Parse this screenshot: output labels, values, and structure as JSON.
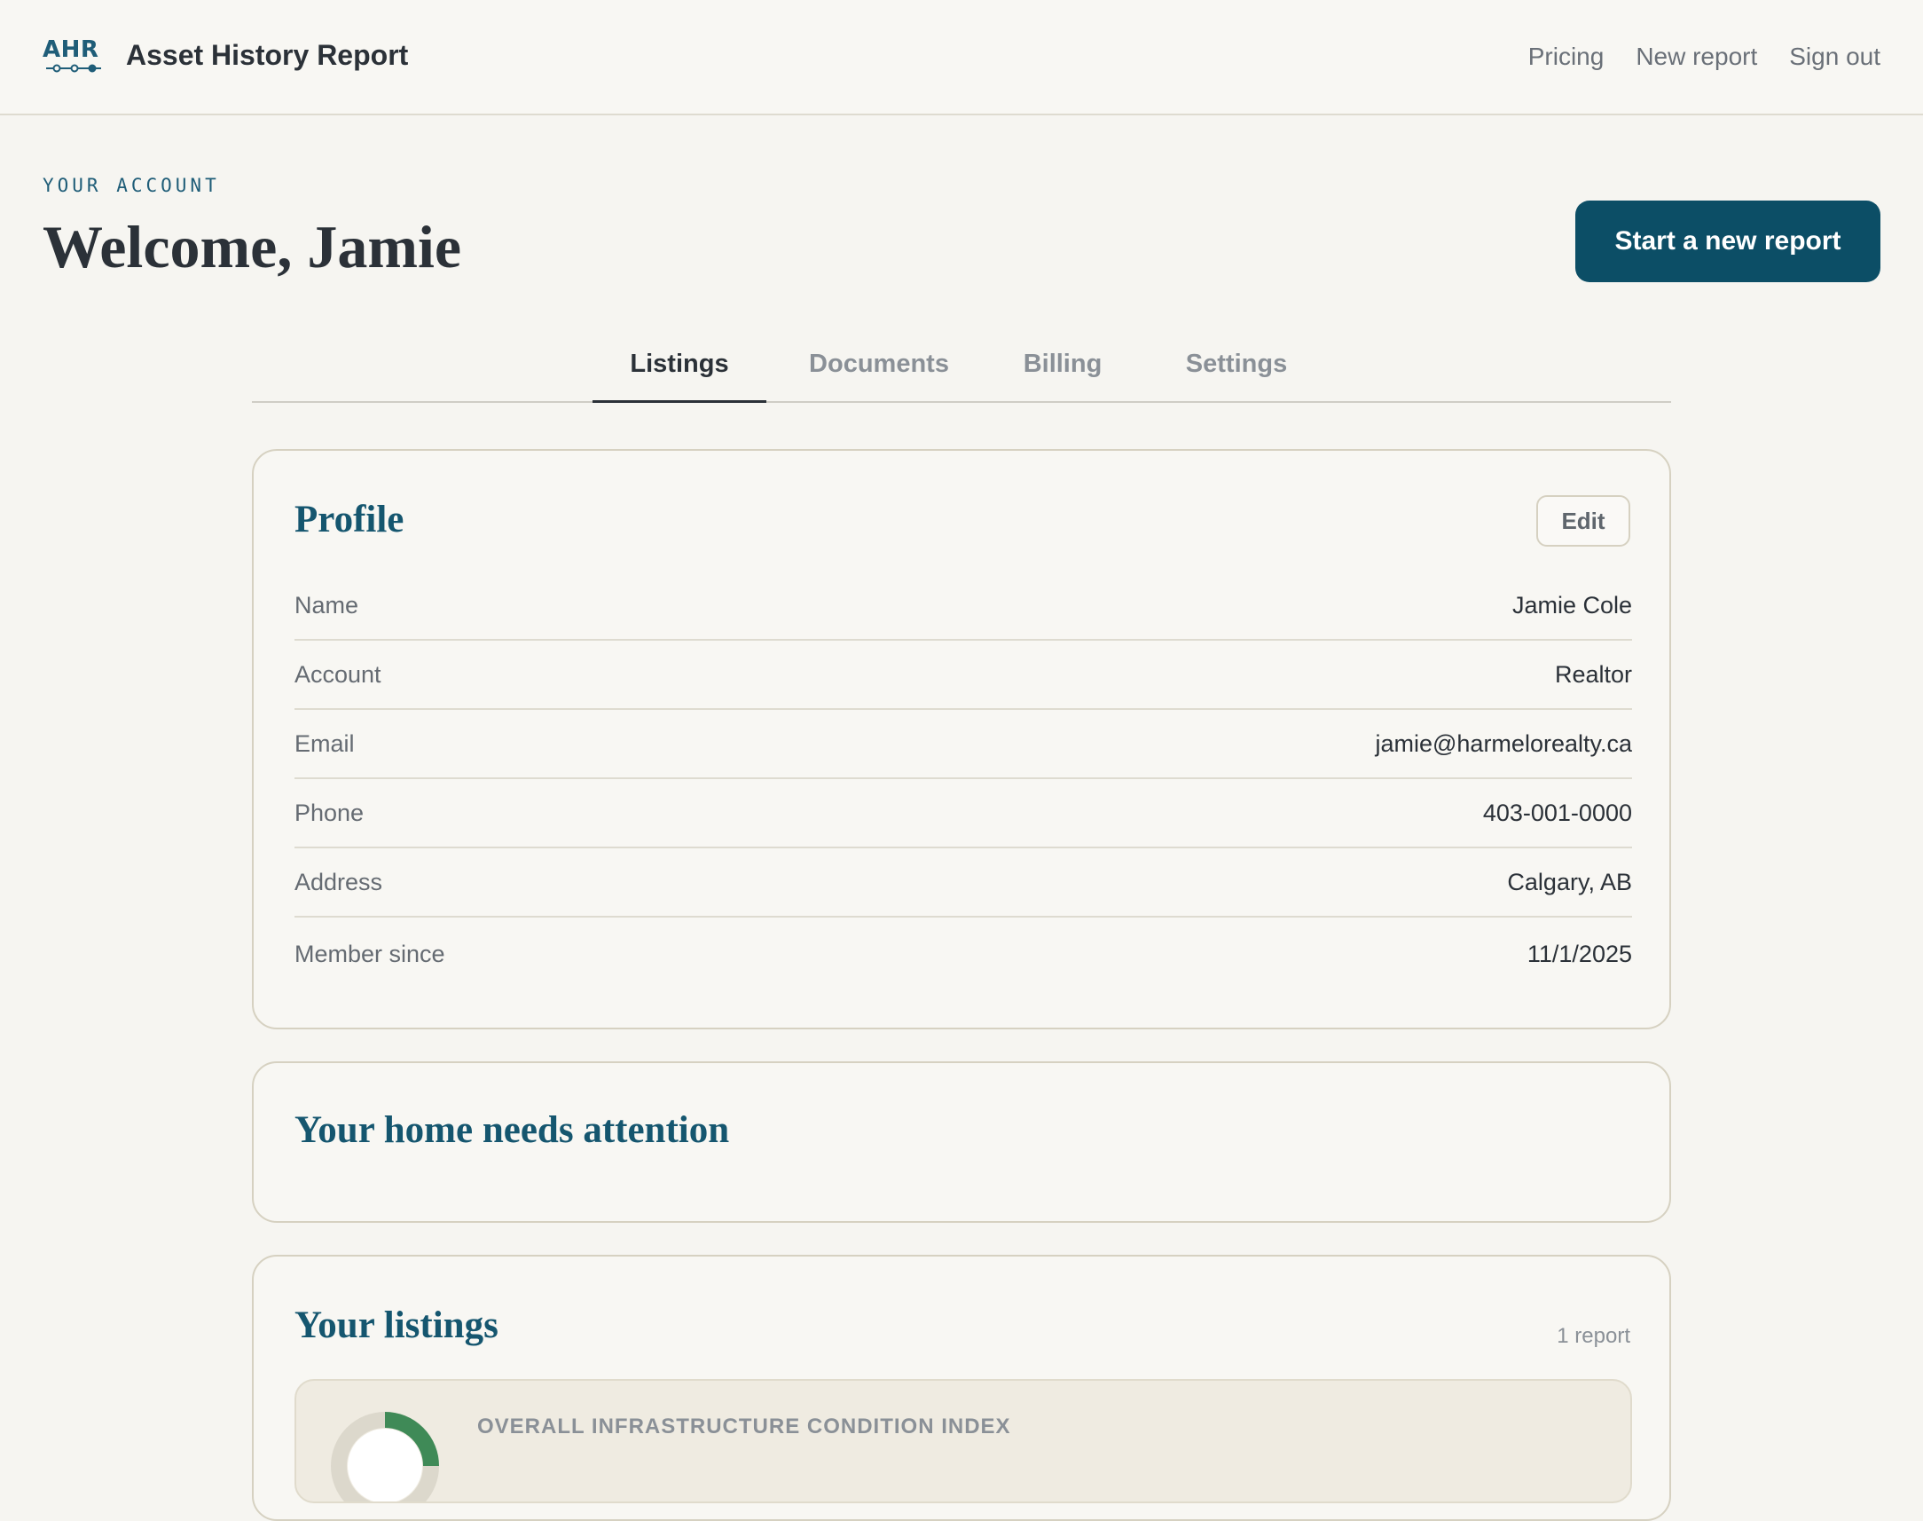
{
  "header": {
    "logo_text": "AHR",
    "app_title": "Asset History Report",
    "nav": [
      "Pricing",
      "New report",
      "Sign out"
    ]
  },
  "hero": {
    "kicker": "YOUR ACCOUNT",
    "welcome": "Welcome, Jamie",
    "cta_label": "Start a new report"
  },
  "tabs": {
    "items": [
      "Listings",
      "Documents",
      "Billing",
      "Settings"
    ],
    "active": "Listings"
  },
  "profile": {
    "title": "Profile",
    "edit_label": "Edit",
    "rows": [
      {
        "label": "Name",
        "value": "Jamie Cole"
      },
      {
        "label": "Account",
        "value": "Realtor"
      },
      {
        "label": "Email",
        "value": "jamie@harmelorealty.ca"
      },
      {
        "label": "Phone",
        "value": "403-001-0000"
      },
      {
        "label": "Address",
        "value": "Calgary, AB"
      },
      {
        "label": "Member since",
        "value": "11/1/2025"
      }
    ]
  },
  "attention": {
    "title": "Your home needs attention"
  },
  "listings": {
    "title": "Your listings",
    "count": "1 report",
    "items": [
      {
        "index_label": "OVERALL INFRASTRUCTURE CONDITION INDEX"
      }
    ]
  },
  "colors": {
    "brand": "#0c4e66",
    "heading": "#15566f",
    "gauge_fill": "#3f8a57",
    "gauge_track": "#dcd8cc"
  }
}
